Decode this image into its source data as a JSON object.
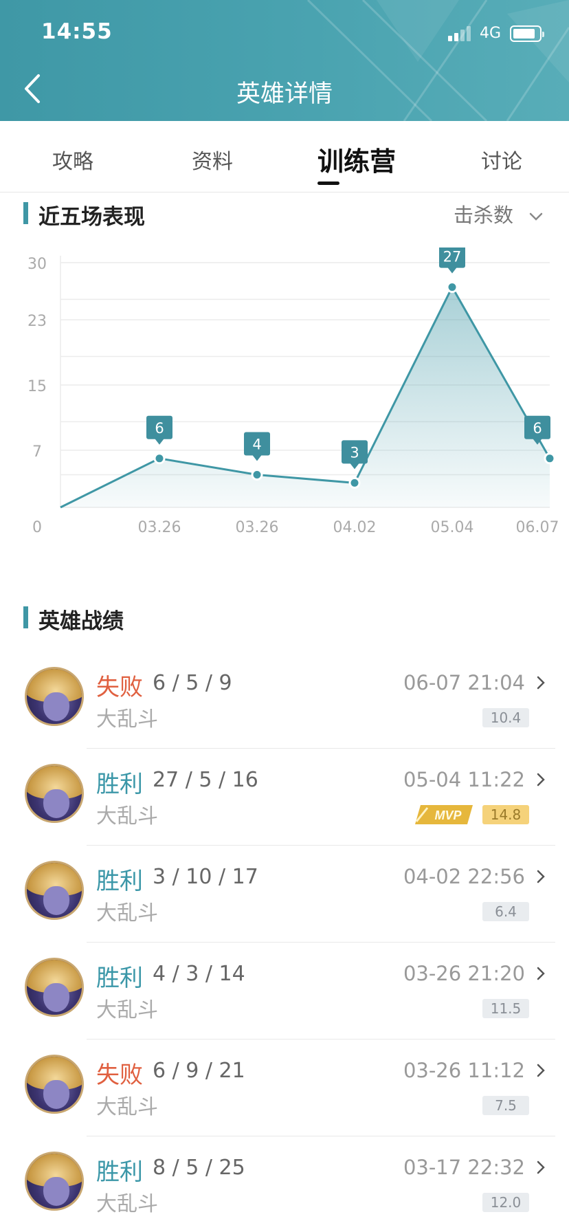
{
  "status_bar": {
    "time": "14:55",
    "network": "4G"
  },
  "nav": {
    "title": "英雄详情"
  },
  "tabs": [
    {
      "label": "攻略",
      "active": false
    },
    {
      "label": "资料",
      "active": false
    },
    {
      "label": "训练营",
      "active": true
    },
    {
      "label": "讨论",
      "active": false
    }
  ],
  "performance": {
    "heading": "近五场表现",
    "metric": "击杀数"
  },
  "chart_data": {
    "type": "area",
    "categories": [
      "03.26",
      "03.26",
      "04.02",
      "05.04",
      "06.07"
    ],
    "values": [
      6,
      4,
      3,
      27,
      6
    ],
    "ylim": [
      0,
      30
    ],
    "y_ticks": [
      "0",
      "7",
      "15",
      "23",
      "30"
    ],
    "grid": true,
    "colors": {
      "line": "#3f97a5",
      "fill": "#3f97a5",
      "label_bg": "#3f8f9e",
      "grid": "#ececec",
      "tick": "#aaaaaa"
    }
  },
  "records_section": {
    "heading": "英雄战绩"
  },
  "records": [
    {
      "result": "失败",
      "outcome": "lose",
      "kda": "6 / 5 / 9",
      "mode": "大乱斗",
      "time": "06-07 21:04",
      "score": "10.4",
      "mvp": false
    },
    {
      "result": "胜利",
      "outcome": "win",
      "kda": "27 / 5 / 16",
      "mode": "大乱斗",
      "time": "05-04 11:22",
      "score": "14.8",
      "mvp": true
    },
    {
      "result": "胜利",
      "outcome": "win",
      "kda": "3 / 10 / 17",
      "mode": "大乱斗",
      "time": "04-02 22:56",
      "score": "6.4",
      "mvp": false
    },
    {
      "result": "胜利",
      "outcome": "win",
      "kda": "4 / 3 / 14",
      "mode": "大乱斗",
      "time": "03-26 21:20",
      "score": "11.5",
      "mvp": false
    },
    {
      "result": "失败",
      "outcome": "lose",
      "kda": "6 / 9 / 21",
      "mode": "大乱斗",
      "time": "03-26 11:12",
      "score": "7.5",
      "mvp": false
    },
    {
      "result": "胜利",
      "outcome": "win",
      "kda": "8 / 5 / 25",
      "mode": "大乱斗",
      "time": "03-17 22:32",
      "score": "12.0",
      "mvp": false
    }
  ],
  "mvp_badge": "MVP"
}
